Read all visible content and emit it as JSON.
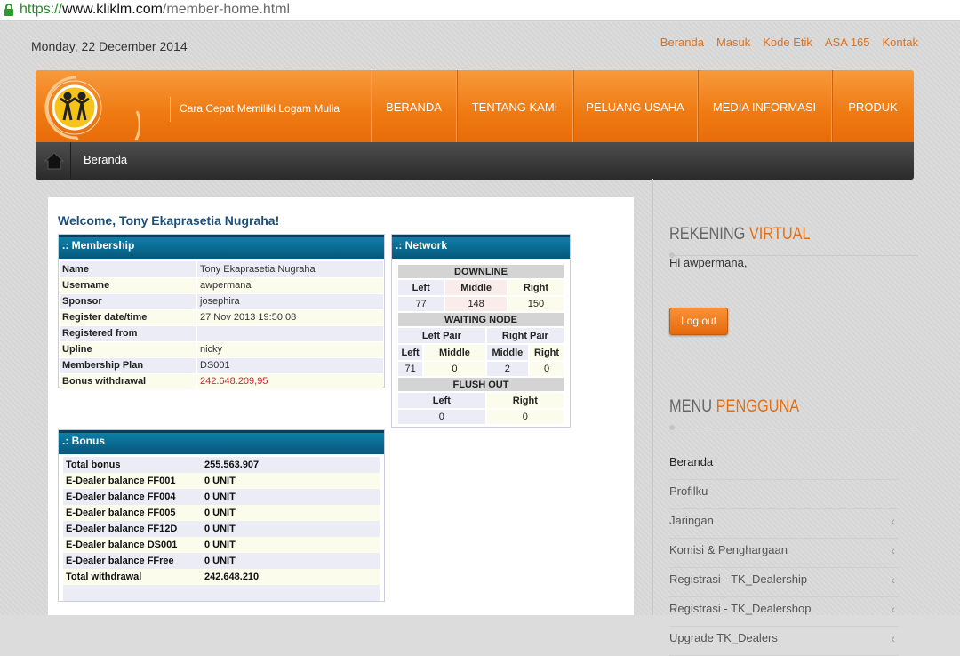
{
  "browser": {
    "proto": "https://",
    "host": "www.kliklm.com",
    "path": "/member-home.html"
  },
  "topbar": {
    "date": "Monday, 22 December 2014",
    "links": [
      "Beranda",
      "Masuk",
      "Kode Etik",
      "ASA 165",
      "Kontak"
    ]
  },
  "header": {
    "tagline": "Cara Cepat Memiliki Logam Mulia",
    "nav": [
      "BERANDA",
      "TENTANG KAMI",
      "PELUANG USAHA",
      "MEDIA INFORMASI",
      "PRODUK"
    ]
  },
  "breadcrumb": {
    "current": "Beranda"
  },
  "main": {
    "welcome": "Welcome, Tony Ekaprasetia Nugraha!",
    "membership": {
      "title": ".: Membership",
      "rows": [
        {
          "k": "Name",
          "v": "Tony Ekaprasetia Nugraha"
        },
        {
          "k": "Username",
          "v": "awpermana"
        },
        {
          "k": "Sponsor",
          "v": "josephira"
        },
        {
          "k": "Register date/time",
          "v": "27 Nov 2013 19:50:08"
        },
        {
          "k": "Registered from",
          "v": ""
        },
        {
          "k": "Upline",
          "v": "nicky"
        },
        {
          "k": "Membership Plan",
          "v": "DS001"
        },
        {
          "k": "Bonus withdrawal",
          "v": "242.648.209,95"
        }
      ]
    },
    "network": {
      "title": ".: Network",
      "downline": {
        "label": "DOWNLINE",
        "left": "Left",
        "middle": "Middle",
        "right": "Right",
        "v_left": "77",
        "v_middle": "148",
        "v_right": "150"
      },
      "waiting": {
        "label": "WAITING NODE",
        "left_pair": "Left Pair",
        "right_pair": "Right Pair",
        "h1": "Left",
        "h2": "Middle",
        "h3": "Middle",
        "h4": "Right",
        "v1": "71",
        "v2": "0",
        "v3": "2",
        "v4": "0"
      },
      "flush": {
        "label": "FLUSH OUT",
        "left": "Left",
        "right": "Right",
        "v_left": "0",
        "v_right": "0"
      }
    },
    "bonus": {
      "title": ".: Bonus",
      "rows": [
        {
          "k": "Total bonus",
          "v": "255.563.907"
        },
        {
          "k": "E-Dealer balance FF001",
          "v": "0 UNIT"
        },
        {
          "k": "E-Dealer balance FF004",
          "v": "0 UNIT"
        },
        {
          "k": "E-Dealer balance FF005",
          "v": "0 UNIT"
        },
        {
          "k": "E-Dealer balance FF12D",
          "v": "0 UNIT"
        },
        {
          "k": "E-Dealer balance DS001",
          "v": "0 UNIT"
        },
        {
          "k": "E-Dealer balance FFree",
          "v": "0 UNIT"
        },
        {
          "k": "Total withdrawal",
          "v": "242.648.210"
        },
        {
          "k": "",
          "v": ""
        }
      ]
    }
  },
  "sidebar": {
    "rekening": {
      "h1": "REKENING",
      "h2": "VIRTUAL"
    },
    "greeting": "Hi awpermana,",
    "logout": "Log out",
    "menu": {
      "h1": "MENU",
      "h2": "PENGGUNA"
    },
    "items": [
      {
        "label": "Beranda",
        "chev": ""
      },
      {
        "label": "Profilku",
        "chev": ""
      },
      {
        "label": "Jaringan",
        "chev": "‹"
      },
      {
        "label": "Komisi & Penghargaan",
        "chev": "‹"
      },
      {
        "label": "Registrasi - TK_Dealership",
        "chev": "‹"
      },
      {
        "label": "Registrasi - TK_Dealershop",
        "chev": "‹"
      },
      {
        "label": "Upgrade TK_Dealers",
        "chev": "‹"
      }
    ]
  },
  "colors": {
    "accent": "#e0701a",
    "nav_orange": "#ef7a12",
    "panel_blue": "#07577a"
  }
}
